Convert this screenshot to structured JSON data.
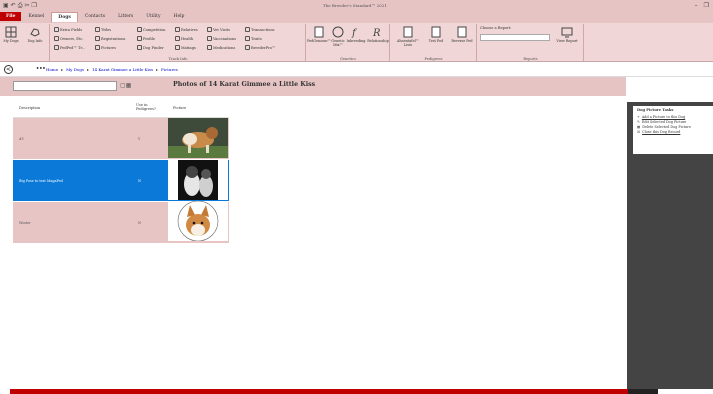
{
  "app": {
    "title": "The Breeder's Standard™ 2021"
  },
  "menu": {
    "file": "File",
    "items": [
      "Kennel",
      "Dogs",
      "Contacts",
      "Litters",
      "Utility",
      "Help"
    ],
    "active": "Dogs"
  },
  "ribbon": {
    "groups": [
      {
        "label": "",
        "buttons": [
          "My Dogs",
          "Dog Info"
        ]
      },
      {
        "label": "Track Info",
        "buttons": [
          "Extra Fields",
          "Owners, Etc.",
          "PedPed™ Tr...",
          "Titles",
          "Registrations",
          "Pictures",
          "Competition",
          "Profile",
          "Dog Finder",
          "Relatives",
          "Health",
          "Matings",
          "Vet Visits",
          "Vaccinations",
          "Medications",
          "Transactions",
          "Traits",
          "BreederPro™"
        ]
      },
      {
        "label": "Genetics",
        "buttons": [
          "PedGenome™",
          "Genetic Mix™",
          "Inbreeding",
          "Relationship"
        ]
      },
      {
        "label": "Pedigrees",
        "buttons": [
          "Ahnentafel™ Lists",
          "Test Ped",
          "Reverse Ped"
        ]
      },
      {
        "label": "Reports",
        "buttons": [
          "Choose a Report:",
          "View Report"
        ]
      }
    ]
  },
  "nav": {
    "crumbs": [
      "Home",
      "My Dogs",
      "14 Karat Gimmee a Little Kiss",
      "Pictures"
    ]
  },
  "page": {
    "title": "Photos of 14 Karat Gimmee a Little Kiss",
    "search_value": ""
  },
  "table": {
    "headers": [
      "Description",
      "Use in Pedigrees?",
      "Picture"
    ],
    "rows": [
      {
        "description": "#1",
        "use": "Y",
        "picture": "dog-photo-1"
      },
      {
        "description": "Big Pose to test MagaPed",
        "use": "N",
        "picture": "dog-photo-2"
      },
      {
        "description": "Winter",
        "use": "N",
        "picture": "dog-photo-3"
      }
    ]
  },
  "tasks": {
    "title": "Dog Picture Tasks",
    "items": [
      "Add a Picture to this Dog",
      "Edit Selected Dog Picture",
      "Delete Selected Dog Picture",
      "Close this Dog Record"
    ]
  },
  "colors": {
    "accent": "#c00000",
    "pink": "#e8c5c5",
    "selected": "#0a79d8"
  }
}
